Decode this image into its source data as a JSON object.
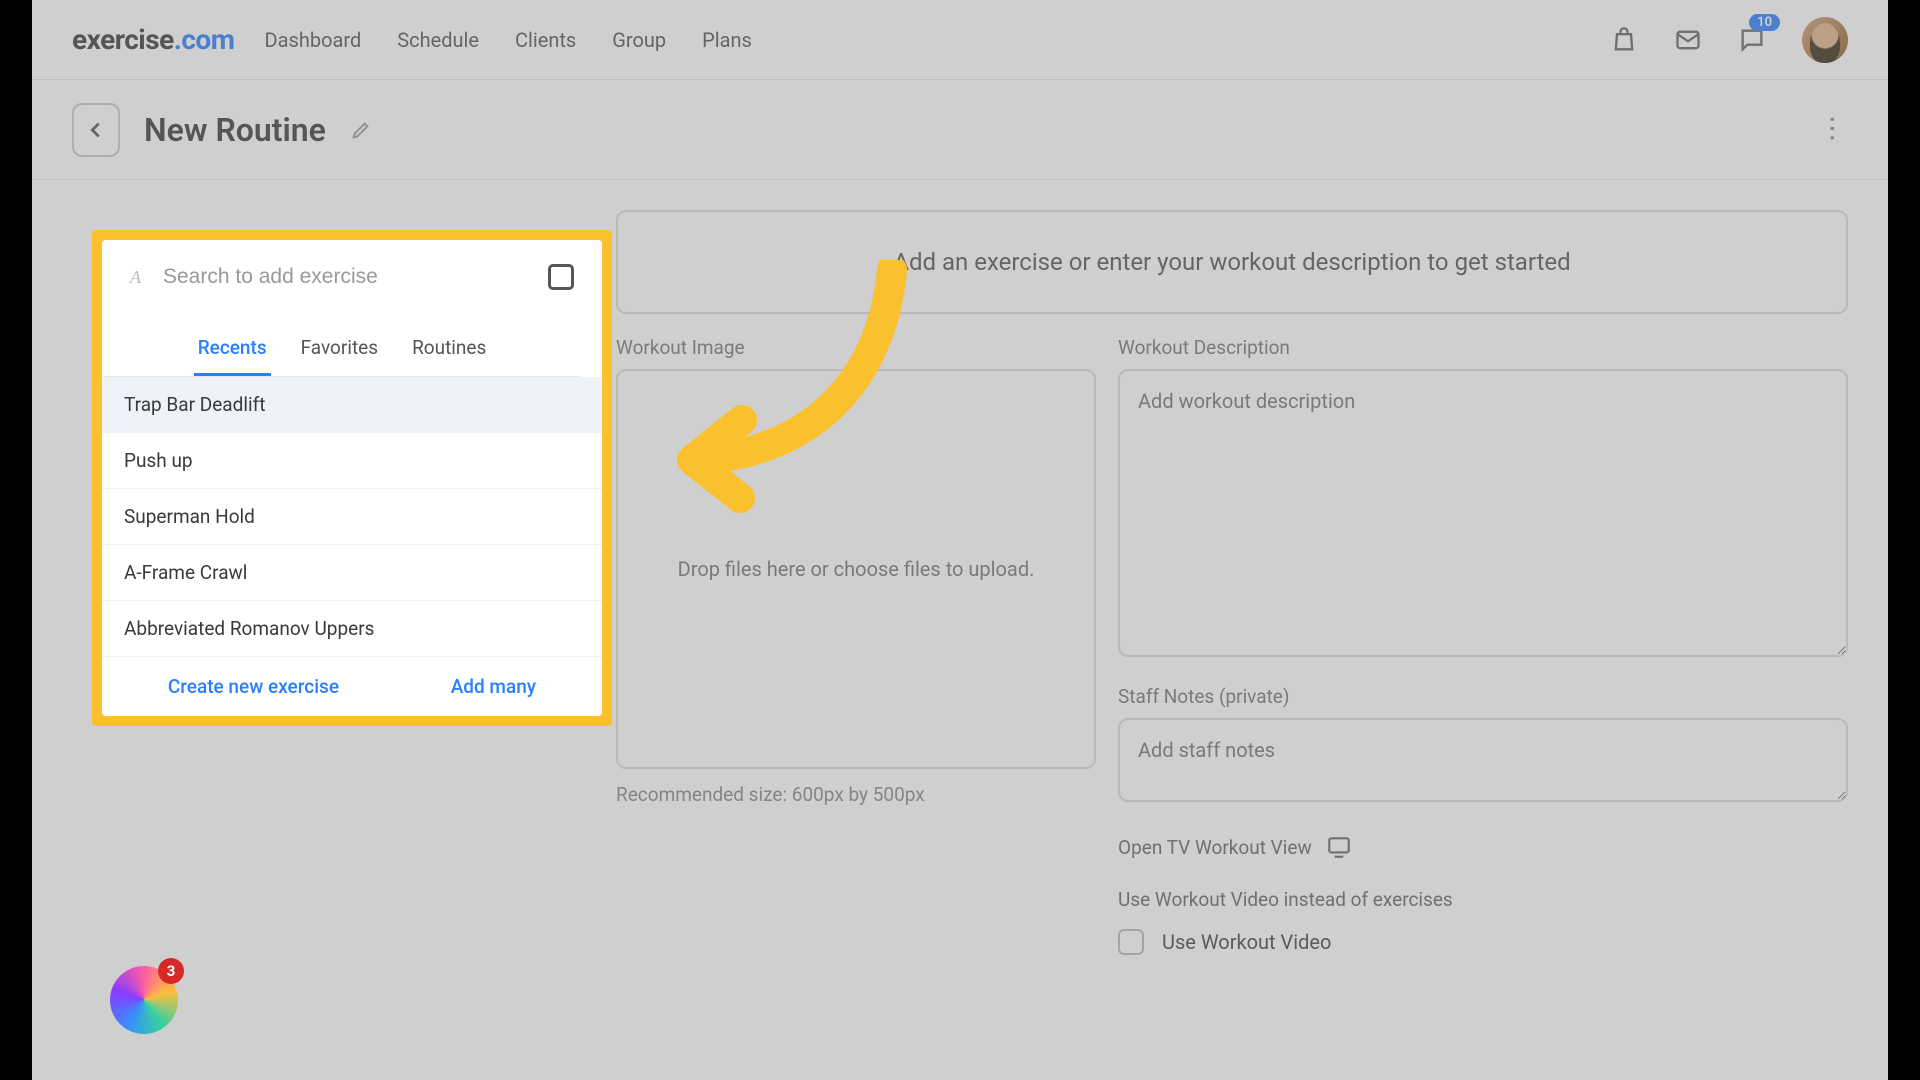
{
  "brand": {
    "a": "exercise",
    "b": ".com"
  },
  "nav": {
    "dashboard": "Dashboard",
    "schedule": "Schedule",
    "clients": "Clients",
    "group": "Group",
    "plans": "Plans"
  },
  "notif_count": "10",
  "page": {
    "title": "New Routine"
  },
  "main": {
    "cta": "Add an exercise or enter your workout description to get started",
    "img_label": "Workout Image",
    "img_drop": "Drop files here or choose files to upload.",
    "img_hint": "Recommended size: 600px by 500px",
    "desc_label": "Workout Description",
    "desc_ph": "Add workout description",
    "staff_label": "Staff Notes (private)",
    "staff_ph": "Add staff notes",
    "tv": "Open TV Workout View",
    "usevideo_title": "Use Workout Video instead of exercises",
    "usevideo_cb": "Use Workout Video"
  },
  "popup": {
    "search_ph": "Search to add exercise",
    "search_val": "A",
    "tabs": {
      "recents": "Recents",
      "favorites": "Favorites",
      "routines": "Routines"
    },
    "items": [
      "Trap Bar Deadlift",
      "Push up",
      "Superman Hold",
      "A-Frame Crawl",
      "Abbreviated Romanov Uppers"
    ],
    "create": "Create new exercise",
    "addmany": "Add many"
  },
  "help_badge": "3"
}
